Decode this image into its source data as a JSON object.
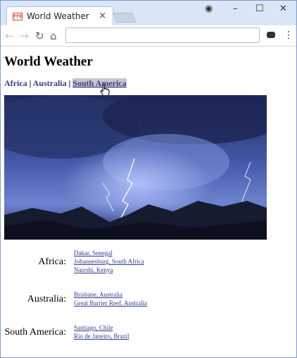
{
  "browser": {
    "tab_title": "World Weather",
    "favicon_text": "FFE",
    "close_glyph": "×",
    "minimize_glyph": "–",
    "maximize_glyph": "☐",
    "window_close_glyph": "✕",
    "profile_glyph": "◉",
    "back_glyph": "←",
    "forward_glyph": "→",
    "reload_glyph": "↻",
    "home_glyph": "⌂",
    "menu_glyph": "⋮",
    "address_value": ""
  },
  "page": {
    "title": "World Weather",
    "nav": {
      "africa": "Africa",
      "australia": "Australia",
      "south_america": "South America",
      "separator": " | "
    },
    "hero_alt": "Lightning storm over mountains",
    "regions": [
      {
        "label": "Africa:",
        "links": [
          "Dakar, Senegal",
          "Johannesburg, South Africa",
          "Nairobi, Kenya"
        ]
      },
      {
        "label": "Australia:",
        "links": [
          "Brisbane, Australia",
          "Great Barrier Reef, Australia"
        ]
      },
      {
        "label": "South America:",
        "links": [
          "Santiago, Chile",
          "Rio de Janeiro, Brazil"
        ]
      }
    ]
  },
  "colors": {
    "link": "#2f3a8f",
    "titlebar": "#dae6f8"
  }
}
